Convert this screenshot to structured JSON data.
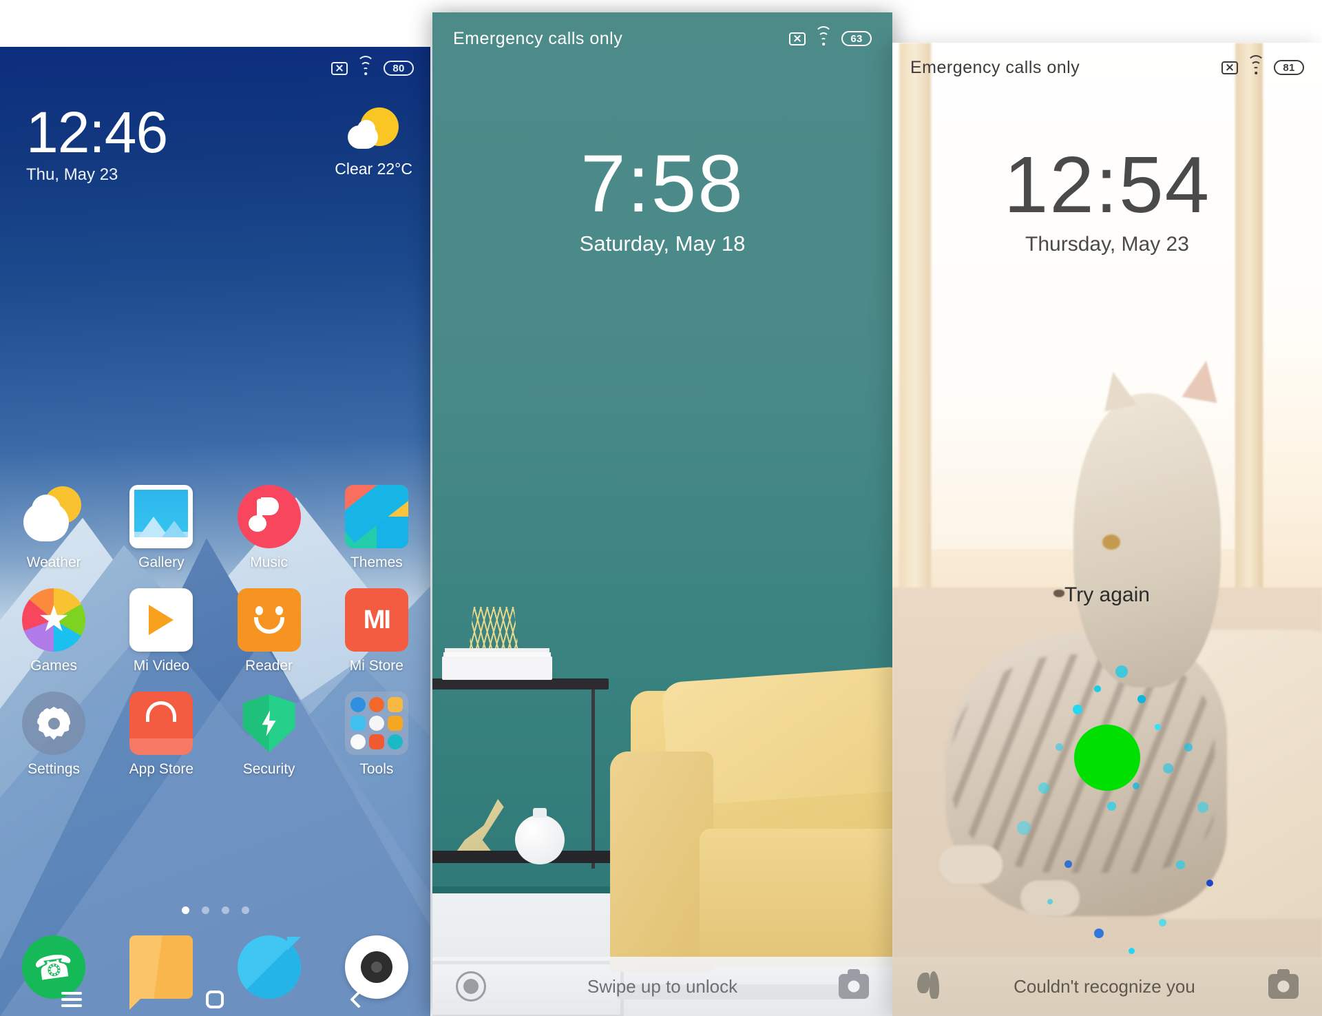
{
  "panels": {
    "home": {
      "statusbar": {
        "battery": "80",
        "icons": [
          "no-sim-icon",
          "wifi-icon",
          "battery-icon"
        ]
      },
      "clock": {
        "time": "12:46",
        "date": "Thu, May 23"
      },
      "weather": {
        "condition": "Clear",
        "temperature": "22°C",
        "summary": "Clear  22°C",
        "icon": "sun-behind-cloud-icon"
      },
      "apps": [
        {
          "label": "Weather",
          "icon": "weather-app-icon"
        },
        {
          "label": "Gallery",
          "icon": "gallery-app-icon"
        },
        {
          "label": "Music",
          "icon": "music-app-icon"
        },
        {
          "label": "Themes",
          "icon": "themes-app-icon"
        },
        {
          "label": "Games",
          "icon": "games-app-icon"
        },
        {
          "label": "Mi Video",
          "icon": "mi-video-app-icon"
        },
        {
          "label": "Reader",
          "icon": "reader-app-icon"
        },
        {
          "label": "Mi Store",
          "icon": "mi-store-app-icon"
        },
        {
          "label": "Settings",
          "icon": "settings-app-icon"
        },
        {
          "label": "App Store",
          "icon": "app-store-app-icon"
        },
        {
          "label": "Security",
          "icon": "security-app-icon"
        },
        {
          "label": "Tools",
          "icon": "tools-folder-icon"
        }
      ],
      "page_indicator": {
        "count": 4,
        "active": 1
      },
      "dock": [
        {
          "name": "Phone",
          "icon": "phone-icon"
        },
        {
          "name": "Messaging",
          "icon": "message-icon"
        },
        {
          "name": "Browser",
          "icon": "browser-icon"
        },
        {
          "name": "Camera",
          "icon": "camera-icon"
        }
      ],
      "navbar": [
        {
          "name": "Menu",
          "icon": "menu-icon"
        },
        {
          "name": "Home",
          "icon": "home-icon"
        },
        {
          "name": "Back",
          "icon": "back-icon"
        }
      ]
    },
    "lock_teal": {
      "statusbar": {
        "carrier": "Emergency calls only",
        "battery": "63"
      },
      "clock": {
        "time": "7:58",
        "date": "Saturday, May 18"
      },
      "unlock_bar": {
        "left_icon": "voice-recorder-icon",
        "hint": "Swipe up to unlock",
        "right_icon": "camera-icon"
      }
    },
    "lock_cat": {
      "statusbar": {
        "carrier": "Emergency calls only",
        "battery": "81"
      },
      "clock": {
        "time": "12:54",
        "date": "Thursday, May 23"
      },
      "face_unlock": {
        "message": "Try again",
        "indicator_color": "#00e000"
      },
      "unlock_bar": {
        "left_icon": "flashlight-flower-icon",
        "hint": "Couldn't recognize you",
        "right_icon": "camera-icon"
      }
    }
  },
  "colors": {
    "home_bg_top": "#0c2d7e",
    "teal_wall": "#3d8583",
    "sofa_yellow": "#edd086",
    "green_indicator": "#00e000",
    "battery_text": "#ffffff"
  }
}
